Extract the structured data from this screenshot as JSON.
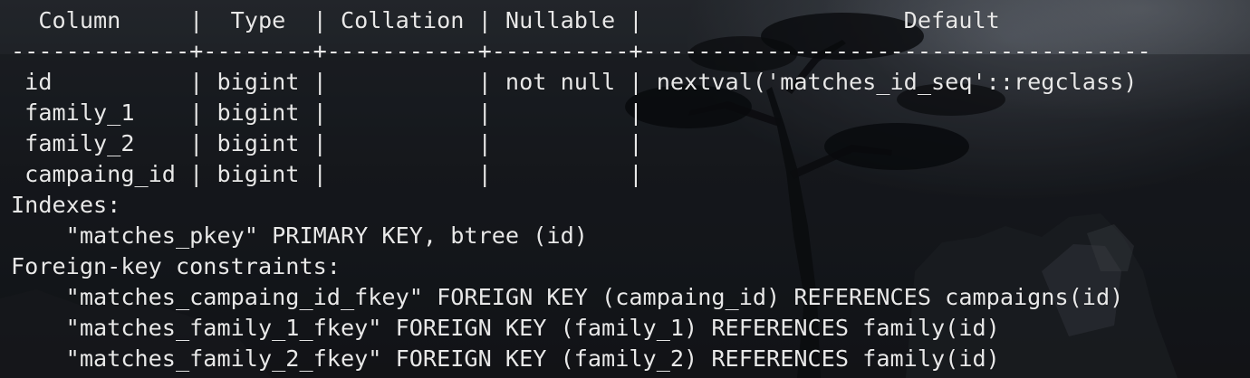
{
  "terminal": {
    "header_row": "  Column     |  Type  | Collation | Nullable |                   Default",
    "separator_row": "-------------+--------+-----------+----------+-------------------------------------",
    "rows": [
      " id          | bigint |           | not null | nextval('matches_id_seq'::regclass)",
      " family_1    | bigint |           |          |",
      " family_2    | bigint |           |          |",
      " campaing_id | bigint |           |          |"
    ],
    "indexes_label": "Indexes:",
    "indexes": [
      "    \"matches_pkey\" PRIMARY KEY, btree (id)"
    ],
    "fk_label": "Foreign-key constraints:",
    "foreign_keys": [
      "    \"matches_campaing_id_fkey\" FOREIGN KEY (campaing_id) REFERENCES campaigns(id)",
      "    \"matches_family_1_fkey\" FOREIGN KEY (family_1) REFERENCES family(id)",
      "    \"matches_family_2_fkey\" FOREIGN KEY (family_2) REFERENCES family(id)"
    ]
  },
  "colors": {
    "text": "#e8e8e8",
    "background": "#1e2126"
  }
}
